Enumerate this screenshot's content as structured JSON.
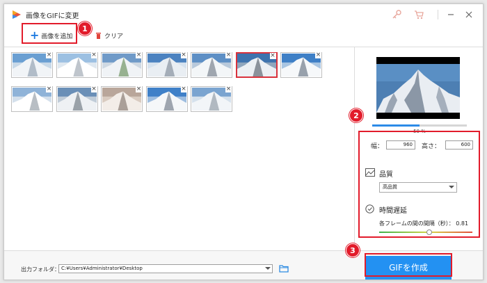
{
  "window": {
    "title": "画像をGIFに変更"
  },
  "toolbar": {
    "add_label": "画像を追加",
    "clear_label": "クリア"
  },
  "callouts": {
    "one": "1",
    "two": "2",
    "three": "3"
  },
  "thumbnails": [
    {
      "style": "sky"
    },
    {
      "style": "snow"
    },
    {
      "style": "green"
    },
    {
      "style": "cloud"
    },
    {
      "style": "range"
    },
    {
      "style": "dark",
      "selected": true
    },
    {
      "style": "blue"
    },
    {
      "style": "snow2"
    },
    {
      "style": "range2"
    },
    {
      "style": "dusk"
    },
    {
      "style": "peak"
    },
    {
      "style": "sky2"
    }
  ],
  "preview": {
    "progress_percent": 50,
    "progress_label": "50 %"
  },
  "settings": {
    "width_label": "幅：",
    "width_value": "960",
    "height_label": "高さ：",
    "height_value": "600",
    "quality_title": "品質",
    "quality_value": "高品質",
    "delay_title": "時間遅延",
    "delay_label": "各フレームの間の間隔（秒）： 0.81",
    "delay_value": 0.81
  },
  "bottom": {
    "output_label": "出力フォルダ：",
    "output_path": "C:¥Users¥Administrator¥Desktop",
    "create_label": "GIFを作成"
  },
  "colors": {
    "accent": "#2391f2",
    "highlight": "#e21b2a"
  }
}
